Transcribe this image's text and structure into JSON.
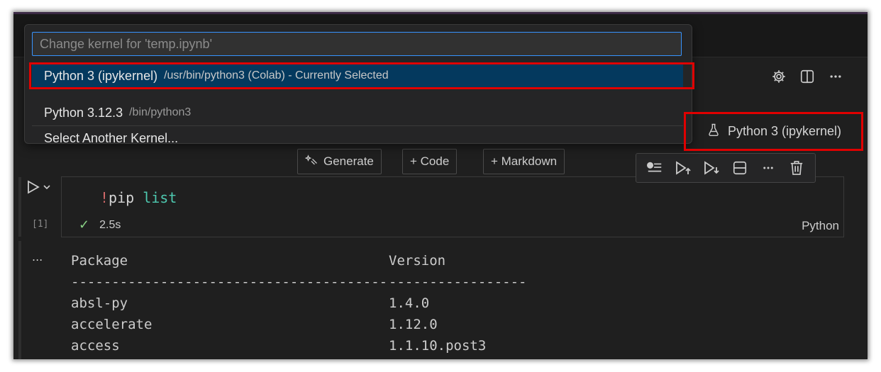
{
  "quickpick": {
    "placeholder": "Change kernel for 'temp.ipynb'",
    "items": [
      {
        "label": "Python 3 (ipykernel)",
        "description": "/usr/bin/python3 (Colab) - Currently Selected",
        "selected": true
      },
      {
        "label": "Python 3.12.3",
        "description": "/bin/python3",
        "selected": false
      },
      {
        "label": "Select Another Kernel...",
        "description": "",
        "selected": false
      }
    ]
  },
  "kernel": {
    "label": "Python 3 (ipykernel)",
    "icon": "flask-icon"
  },
  "insert_toolbar": {
    "generate": "Generate",
    "code": "+ Code",
    "markdown": "+ Markdown"
  },
  "cell_toolbar": {
    "icons": [
      "run-by-line-icon",
      "execute-above-icon",
      "execute-below-icon",
      "split-cell-icon",
      "more-icon",
      "delete-icon"
    ]
  },
  "cell": {
    "execution_count": "[1]",
    "code_bang": "!",
    "code_cmd": "pip",
    "code_arg": "list",
    "duration": "2.5s",
    "language": "Python"
  },
  "output": {
    "more": "...",
    "header": [
      "Package",
      "Version"
    ],
    "separator": [
      "---------------------------------------",
      "-----------------"
    ],
    "rows": [
      [
        "absl-py",
        "1.4.0"
      ],
      [
        "accelerate",
        "1.12.0"
      ],
      [
        "access",
        "1.1.10.post3"
      ]
    ]
  },
  "colors": {
    "accent": "#3794ff",
    "selection": "#04395e",
    "highlight": "#e00000"
  }
}
